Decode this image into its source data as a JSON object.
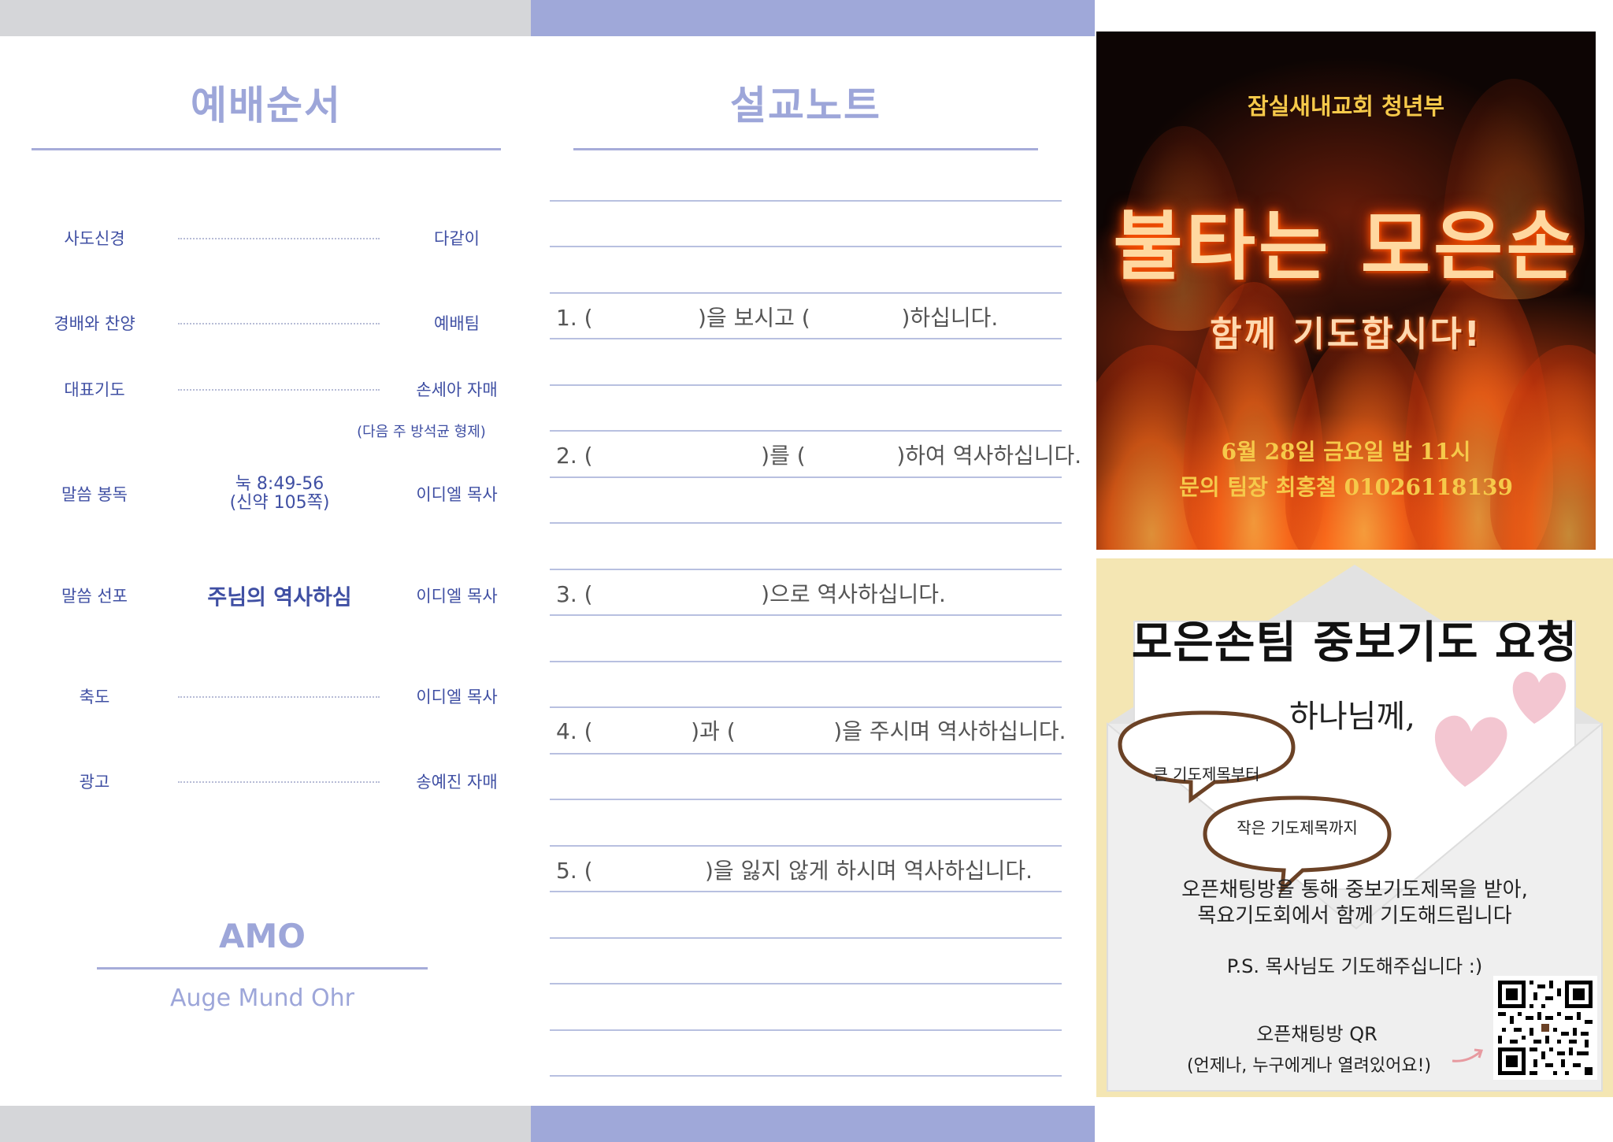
{
  "colors": {
    "bar_gray": "#d5d6d9",
    "bar_blue": "#9fa8d9",
    "accent_blue": "#9da6d9",
    "text_blue": "#3f4fa3",
    "card_bg": "#f4e6b3"
  },
  "order_of_worship": {
    "title": "예배순서",
    "rows": [
      {
        "label": "사도신경",
        "middle": "",
        "right": "다같이"
      },
      {
        "label": "경배와 찬양",
        "middle": "",
        "right": "예배팀"
      },
      {
        "label": "대표기도",
        "middle": "",
        "right": "손세아 자매"
      },
      {
        "label": "말씀 봉독",
        "middle": "눅 8:49-56",
        "middle2": "(신약 105쪽)",
        "right": "이디엘 목사"
      },
      {
        "label": "말씀 선포",
        "middle": "주님의 역사하심",
        "right": "이디엘 목사"
      },
      {
        "label": "축도",
        "middle": "",
        "right": "이디엘 목사"
      },
      {
        "label": "광고",
        "middle": "",
        "right": "송예진 자매"
      }
    ],
    "next_week_note": "(다음 주 방석균 형제)",
    "footer_title": "AMO",
    "footer_sub": "Auge Mund Ohr"
  },
  "sermon_notes": {
    "title": "설교노트",
    "items": [
      "1. (               )을 보시고 (             )하십니다.",
      "2. (                        )를 (             )하여 역사하십니다.",
      "3. (                        )으로 역사하십니다.",
      "4. (              )과 (              )을 주시며 역사하십니다.",
      "5. (                )을 잃지 않게 하시며 역사하십니다."
    ]
  },
  "flyer": {
    "church": "잠실새내교회 청년부",
    "title": "불타는 모은손",
    "subtitle": "함께 기도합시다!",
    "date": "6월 28일 금요일 밤 11시",
    "contact": "문의 팀장 최홍철 01026118139"
  },
  "prayer_card": {
    "title": "모은손팀 중보기도 요청",
    "letter_greeting": "하나님께,",
    "bubble1": "큰 기도제목부터",
    "bubble2": "작은 기도제목까지",
    "body_line1": "오픈채팅방을 통해 중보기도제목을 받아,",
    "body_line2": "목요기도회에서 함께 기도해드립니다",
    "ps": "P.S. 목사님도 기도해주십니다 :)",
    "qr_label": "오픈채팅방 QR",
    "qr_note": "(언제나, 누구에게나 열려있어요!)"
  }
}
